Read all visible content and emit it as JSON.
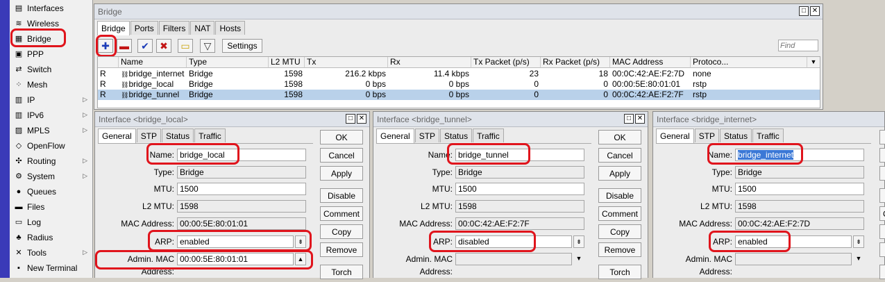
{
  "sidebar": {
    "items": [
      {
        "label": "Interfaces",
        "icon": "interfaces-icon",
        "glyph": "▤",
        "arrow": ""
      },
      {
        "label": "Wireless",
        "icon": "wireless-icon",
        "glyph": "≋",
        "arrow": ""
      },
      {
        "label": "Bridge",
        "icon": "bridge-icon",
        "glyph": "▦",
        "arrow": ""
      },
      {
        "label": "PPP",
        "icon": "ppp-icon",
        "glyph": "▣",
        "arrow": ""
      },
      {
        "label": "Switch",
        "icon": "switch-icon",
        "glyph": "⇄",
        "arrow": ""
      },
      {
        "label": "Mesh",
        "icon": "mesh-icon",
        "glyph": "⁘",
        "arrow": ""
      },
      {
        "label": "IP",
        "icon": "ip-icon",
        "glyph": "▥",
        "arrow": "▷"
      },
      {
        "label": "IPv6",
        "icon": "ipv6-icon",
        "glyph": "▥",
        "arrow": "▷"
      },
      {
        "label": "MPLS",
        "icon": "mpls-icon",
        "glyph": "▨",
        "arrow": "▷"
      },
      {
        "label": "OpenFlow",
        "icon": "openflow-icon",
        "glyph": "◇",
        "arrow": ""
      },
      {
        "label": "Routing",
        "icon": "routing-icon",
        "glyph": "✣",
        "arrow": "▷"
      },
      {
        "label": "System",
        "icon": "system-icon",
        "glyph": "⚙",
        "arrow": "▷"
      },
      {
        "label": "Queues",
        "icon": "queues-icon",
        "glyph": "●",
        "arrow": ""
      },
      {
        "label": "Files",
        "icon": "files-icon",
        "glyph": "▬",
        "arrow": ""
      },
      {
        "label": "Log",
        "icon": "log-icon",
        "glyph": "▭",
        "arrow": ""
      },
      {
        "label": "Radius",
        "icon": "radius-icon",
        "glyph": "♣",
        "arrow": ""
      },
      {
        "label": "Tools",
        "icon": "tools-icon",
        "glyph": "✕",
        "arrow": "▷"
      },
      {
        "label": "New Terminal",
        "icon": "terminal-icon",
        "glyph": "▪",
        "arrow": ""
      }
    ]
  },
  "bridge": {
    "title": "Bridge",
    "tabs": [
      "Bridge",
      "Ports",
      "Filters",
      "NAT",
      "Hosts"
    ],
    "settings_label": "Settings",
    "find_placeholder": "Find",
    "columns": [
      "",
      "Name",
      "Type",
      "L2 MTU",
      "Tx",
      "Rx",
      "Tx Packet (p/s)",
      "Rx Packet (p/s)",
      "MAC Address",
      "Protoco..."
    ],
    "rows": [
      {
        "flag": "R",
        "name": "bridge_internet",
        "type": "Bridge",
        "l2mtu": "1598",
        "tx": "216.2 kbps",
        "rx": "11.4 kbps",
        "txp": "23",
        "rxp": "18",
        "mac": "00:0C:42:AE:F2:7D",
        "proto": "none"
      },
      {
        "flag": "R",
        "name": "bridge_local",
        "type": "Bridge",
        "l2mtu": "1598",
        "tx": "0 bps",
        "rx": "0 bps",
        "txp": "0",
        "rxp": "0",
        "mac": "00:00:5E:80:01:01",
        "proto": "rstp"
      },
      {
        "flag": "R",
        "name": "bridge_tunnel",
        "type": "Bridge",
        "l2mtu": "1598",
        "tx": "0 bps",
        "rx": "0 bps",
        "txp": "0",
        "rxp": "0",
        "mac": "00:0C:42:AE:F2:7F",
        "proto": "rstp"
      }
    ]
  },
  "field_labels": {
    "name": "Name:",
    "type": "Type:",
    "mtu": "MTU:",
    "l2mtu": "L2 MTU:",
    "mac": "MAC Address:",
    "arp": "ARP:",
    "admin_mac": "Admin. MAC Address:"
  },
  "dialog_tabs": [
    "General",
    "STP",
    "Status",
    "Traffic"
  ],
  "dialog_buttons": [
    "OK",
    "Cancel",
    "Apply",
    "Disable",
    "Comment",
    "Copy",
    "Remove",
    "Torch"
  ],
  "dialogs": [
    {
      "title": "Interface <bridge_local>",
      "name": "bridge_local",
      "type": "Bridge",
      "mtu": "1500",
      "l2mtu": "1598",
      "mac": "00:00:5E:80:01:01",
      "arp": "enabled",
      "admin_mac": "00:00:5E:80:01:01"
    },
    {
      "title": "Interface <bridge_tunnel>",
      "name": "bridge_tunnel",
      "type": "Bridge",
      "mtu": "1500",
      "l2mtu": "1598",
      "mac": "00:0C:42:AE:F2:7F",
      "arp": "disabled",
      "admin_mac": ""
    },
    {
      "title": "Interface <bridge_internet>",
      "name": "bridge_internet",
      "type": "Bridge",
      "mtu": "1500",
      "l2mtu": "1598",
      "mac": "00:0C:42:AE:F2:7D",
      "arp": "enabled",
      "admin_mac": ""
    }
  ],
  "colors": {
    "highlight": "#e0141c",
    "selection": "#b9d1ea",
    "menu_strip": "#3a3ab8"
  }
}
